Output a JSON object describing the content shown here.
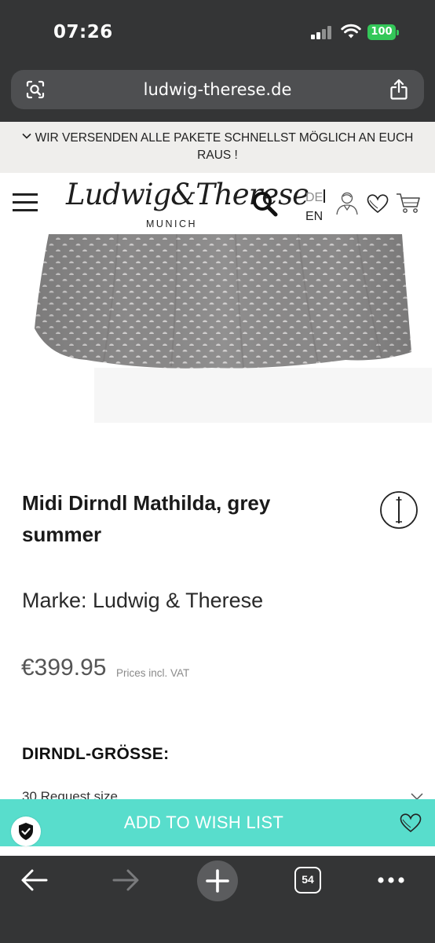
{
  "status_bar": {
    "time": "07:26",
    "battery": "100"
  },
  "browser": {
    "url": "ludwig-therese.de",
    "tab_count": "54"
  },
  "announcement": {
    "text": "WIR VERSENDEN ALLE PAKETE SCHNELLST MÖGLICH AN EUCH RAUS !"
  },
  "header": {
    "logo_script": "Ludwig&Therese",
    "logo_city": "MUNICH",
    "lang_de": "DE",
    "lang_en": "EN"
  },
  "carousel": {
    "slide_count": 4,
    "active_index": 1
  },
  "product": {
    "title": "Midi Dirndl Mathilda, grey summer",
    "brand": "Marke: Ludwig & Therese",
    "price": "€399.95",
    "price_note": "Prices incl. VAT",
    "size_label": "DIRNDL-GRÖSSE:",
    "size_selected": "30 Request size"
  },
  "wishlist": {
    "label": "ADD TO WISH LIST"
  },
  "colors": {
    "chrome": "#343536",
    "url_field": "#4e4f51",
    "announcement_bg": "#efeeec",
    "wishlist_bg": "#58ddcc",
    "battery": "#34c759",
    "fabric": "#8c8b8b"
  },
  "icons": [
    "lens-icon",
    "share-icon",
    "menu-icon",
    "search-icon",
    "user-icon",
    "heart-icon",
    "cart-icon",
    "info-icon",
    "chevron-down-icon",
    "shield-check-icon",
    "back-arrow-icon",
    "forward-arrow-icon",
    "plus-icon",
    "tabs-icon",
    "more-icon"
  ]
}
